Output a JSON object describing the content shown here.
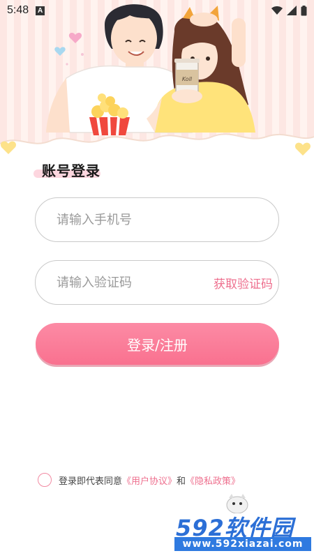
{
  "status_bar": {
    "time": "5:48",
    "notification_icon": "A",
    "icons": [
      "wifi-icon",
      "signal-icon",
      "battery-icon"
    ]
  },
  "hero": {
    "illustration": "couple-with-popcorn-and-drink",
    "cup_text": "Koll"
  },
  "login": {
    "title": "账号登录",
    "phone_placeholder": "请输入手机号",
    "phone_value": "",
    "code_placeholder": "请输入验证码",
    "code_value": "",
    "get_code_label": "获取验证码",
    "submit_label": "登录/注册"
  },
  "agreement": {
    "checked": false,
    "prefix": "登录即代表同意",
    "user_agreement": "《用户协议》",
    "conjunction": "和",
    "privacy_policy": "《隐私政策》"
  },
  "watermark": {
    "brand": "592软件园",
    "url": "www.592xiazai.com"
  },
  "colors": {
    "accent": "#f9718f",
    "link": "#ee6f8e",
    "title_highlight": "#fdd6df",
    "watermark_blue": "#2c6fd6"
  }
}
